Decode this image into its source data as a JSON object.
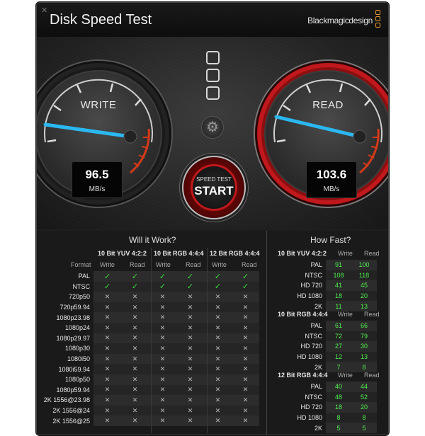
{
  "window": {
    "title": "Disk Speed Test",
    "brand": "Blackmagicdesign"
  },
  "write_gauge": {
    "label": "WRITE",
    "value": "96.5",
    "unit": "MB/s"
  },
  "read_gauge": {
    "label": "READ",
    "value": "103.6",
    "unit": "MB/s"
  },
  "start_button": {
    "small": "SPEED TEST",
    "big": "START"
  },
  "will_it_work": {
    "title": "Will it Work?",
    "format_label": "Format",
    "groups": [
      "10 Bit YUV 4:2:2",
      "10 Bit RGB 4:4:4",
      "12 Bit RGB 4:4:4"
    ],
    "cols": [
      "Write",
      "Read"
    ],
    "rows": [
      {
        "format": "PAL",
        "checks": [
          true,
          true,
          true,
          true,
          true,
          true
        ]
      },
      {
        "format": "NTSC",
        "checks": [
          true,
          true,
          true,
          true,
          true,
          true
        ]
      },
      {
        "format": "720p50",
        "checks": [
          false,
          false,
          false,
          false,
          false,
          false
        ]
      },
      {
        "format": "720p59.94",
        "checks": [
          false,
          false,
          false,
          false,
          false,
          false
        ]
      },
      {
        "format": "1080p23.98",
        "checks": [
          false,
          false,
          false,
          false,
          false,
          false
        ]
      },
      {
        "format": "1080p24",
        "checks": [
          false,
          false,
          false,
          false,
          false,
          false
        ]
      },
      {
        "format": "1080p29.97",
        "checks": [
          false,
          false,
          false,
          false,
          false,
          false
        ]
      },
      {
        "format": "1080p30",
        "checks": [
          false,
          false,
          false,
          false,
          false,
          false
        ]
      },
      {
        "format": "1080i50",
        "checks": [
          false,
          false,
          false,
          false,
          false,
          false
        ]
      },
      {
        "format": "1080i59.94",
        "checks": [
          false,
          false,
          false,
          false,
          false,
          false
        ]
      },
      {
        "format": "1080p50",
        "checks": [
          false,
          false,
          false,
          false,
          false,
          false
        ]
      },
      {
        "format": "1080p59.94",
        "checks": [
          false,
          false,
          false,
          false,
          false,
          false
        ]
      },
      {
        "format": "2K 1556@23.98",
        "checks": [
          false,
          false,
          false,
          false,
          false,
          false
        ]
      },
      {
        "format": "2K 1556@24",
        "checks": [
          false,
          false,
          false,
          false,
          false,
          false
        ]
      },
      {
        "format": "2K 1556@25",
        "checks": [
          false,
          false,
          false,
          false,
          false,
          false
        ]
      }
    ]
  },
  "how_fast": {
    "title": "How Fast?",
    "cols": [
      "Write",
      "Read"
    ],
    "groups": [
      {
        "name": "10 Bit YUV 4:2:2",
        "rows": [
          {
            "format": "PAL",
            "write": "91",
            "read": "100"
          },
          {
            "format": "NTSC",
            "write": "108",
            "read": "118"
          },
          {
            "format": "HD 720",
            "write": "41",
            "read": "45"
          },
          {
            "format": "HD 1080",
            "write": "18",
            "read": "20"
          },
          {
            "format": "2K",
            "write": "11",
            "read": "13"
          }
        ]
      },
      {
        "name": "10 Bit RGB 4:4:4",
        "rows": [
          {
            "format": "PAL",
            "write": "61",
            "read": "66"
          },
          {
            "format": "NTSC",
            "write": "72",
            "read": "79"
          },
          {
            "format": "HD 720",
            "write": "27",
            "read": "30"
          },
          {
            "format": "HD 1080",
            "write": "12",
            "read": "13"
          },
          {
            "format": "2K",
            "write": "7",
            "read": "8"
          }
        ]
      },
      {
        "name": "12 Bit RGB 4:4:4",
        "rows": [
          {
            "format": "PAL",
            "write": "40",
            "read": "44"
          },
          {
            "format": "NTSC",
            "write": "48",
            "read": "52"
          },
          {
            "format": "HD 720",
            "write": "18",
            "read": "20"
          },
          {
            "format": "HD 1080",
            "write": "8",
            "read": "8"
          },
          {
            "format": "2K",
            "write": "5",
            "read": "5"
          }
        ]
      }
    ]
  },
  "colors": {
    "needle": "#2bb8f0",
    "redline": "#d43a1a",
    "read_bezel": "#c0181c",
    "check": "#3ddc3d",
    "speed_value": "#4ef04e"
  }
}
